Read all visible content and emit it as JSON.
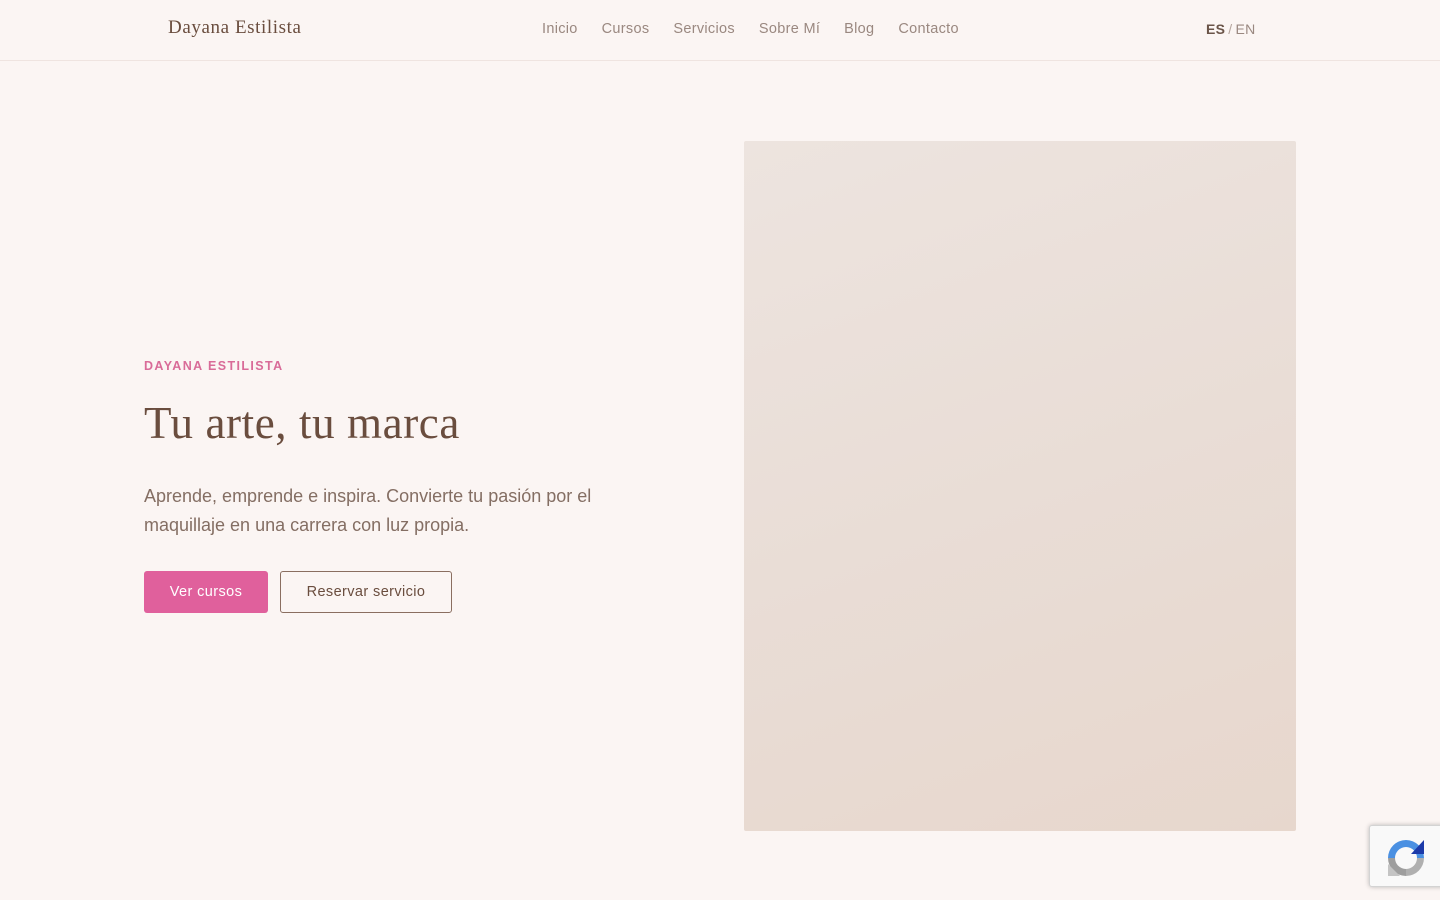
{
  "header": {
    "logo": "Dayana Estilista",
    "nav": [
      {
        "label": "Inicio"
      },
      {
        "label": "Cursos"
      },
      {
        "label": "Servicios"
      },
      {
        "label": "Sobre Mí"
      },
      {
        "label": "Blog"
      },
      {
        "label": "Contacto"
      }
    ],
    "lang": {
      "active": "ES",
      "separator": "/",
      "other": "EN"
    }
  },
  "hero": {
    "eyebrow": "DAYANA ESTILISTA",
    "title": "Tu arte, tu marca",
    "description": "Aprende, emprende e inspira. Convierte tu pasión por el maquillaje en una carrera con luz propia.",
    "primary_button": "Ver cursos",
    "secondary_button": "Reservar servicio"
  },
  "colors": {
    "background": "#fbf5f3",
    "accent": "#e0609c",
    "eyebrow": "#d96b98",
    "heading": "#6a4d3e"
  },
  "widgets": {
    "recaptcha_icon": "recaptcha-icon"
  }
}
